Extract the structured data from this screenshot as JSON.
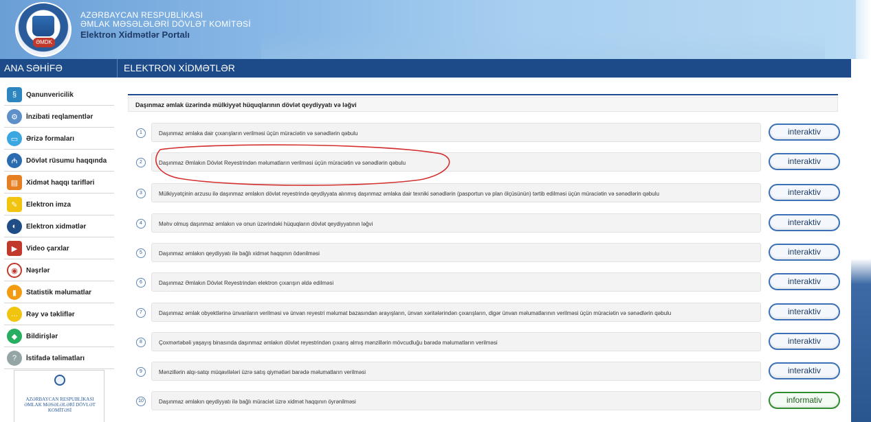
{
  "header": {
    "line1": "AZƏRBAYCAN RESPUBLİKASI",
    "line2": "ƏMLAK MƏSƏLƏLƏRİ DÖVLƏT KOMİTƏSİ",
    "line3": "Elektron Xidmətlər Portalı",
    "logo_badge": "ƏMDK"
  },
  "nav": {
    "home": "ANA SƏHİFƏ",
    "services": "ELEKTRON XİDMƏTLƏR"
  },
  "sidebar": {
    "items": [
      {
        "label": "Qanunvericilik",
        "icon": "law-icon",
        "color": "#2e86c1"
      },
      {
        "label": "İnzibati reqlamentlər",
        "icon": "gear-icon",
        "color": "#5d8fc8"
      },
      {
        "label": "Ərizə formaları",
        "icon": "form-icon",
        "color": "#3aa7e0"
      },
      {
        "label": "Dövlət rüsumu haqqında",
        "icon": "fee-icon",
        "color": "#2b6cb0"
      },
      {
        "label": "Xidmət haqqı tarifləri",
        "icon": "tariff-icon",
        "color": "#e67e22"
      },
      {
        "label": "Elektron imza",
        "icon": "signature-icon",
        "color": "#f1c40f"
      },
      {
        "label": "Elektron xidmətlər",
        "icon": "eservice-icon",
        "color": "#1f4e87"
      },
      {
        "label": "Video çarxlar",
        "icon": "video-icon",
        "color": "#c0392b"
      },
      {
        "label": "Nəşrlər",
        "icon": "publication-icon",
        "color": "#7f8c8d"
      },
      {
        "label": "Statistik məlumatlar",
        "icon": "statistics-icon",
        "color": "#f39c12"
      },
      {
        "label": "Rəy və təkliflər",
        "icon": "feedback-icon",
        "color": "#f1c40f"
      },
      {
        "label": "Bildirişlər",
        "icon": "notification-icon",
        "color": "#27ae60"
      },
      {
        "label": "İstifadə təlimatları",
        "icon": "manual-icon",
        "color": "#95a5a6"
      }
    ],
    "card_text": "AZƏRBAYCAN RESPUBLİKASI ƏMLAK MƏSƏLƏLƏRİ DÖVLƏT KOMİTƏSİ"
  },
  "main": {
    "section_title": "Daşınmaz əmlak üzərində mülkiyyət hüquqlarının dövlət qeydiyyatı və ləğvi",
    "rows": [
      {
        "num": "1",
        "text": "Daşınmaz əmlaka dair çıxarışların verilməsi üçün müraciətin və sənədlərin qəbulu",
        "button": "interaktiv",
        "type": "interactive"
      },
      {
        "num": "2",
        "text": "Daşınmaz Əmlakın Dövlət Reyestrindən məlumatların verilməsi üçün müraciətin və sənədlərin qəbulu",
        "button": "interaktiv",
        "type": "interactive"
      },
      {
        "num": "3",
        "text": "Mülkiyyətçinin arzusu ilə daşınmaz əmlakın dövlət reyestrində qeydiyyata alınmış daşınmaz əmlaka dair texniki sənədlərin (pasportun və plan ölçüsünün) tərtib edilməsi üçün müraciətin və sənədlərin qəbulu",
        "button": "interaktiv",
        "type": "interactive"
      },
      {
        "num": "4",
        "text": "Məhv olmuş daşınmaz əmlakın və onun üzərindəki hüquqların dövlət qeydiyyatının ləğvi",
        "button": "interaktiv",
        "type": "interactive"
      },
      {
        "num": "5",
        "text": "Daşınmaz əmlakın qeydiyyatı ilə bağlı xidmət haqqının ödənilməsi",
        "button": "interaktiv",
        "type": "interactive"
      },
      {
        "num": "6",
        "text": "Daşınmaz Əmlakın Dövlət Reyestrindən elektron çıxarışın əldə edilməsi",
        "button": "interaktiv",
        "type": "interactive"
      },
      {
        "num": "7",
        "text": "Daşınmaz əmlak obyektlərinə ünvanların verilməsi və ünvan reyestri məlumat bazasından arayışların, ünvan xəritələrindən çıxarışların, digər ünvan məlumatlarının verilməsi üçün müraciətin və sənədlərin qəbulu",
        "button": "interaktiv",
        "type": "interactive"
      },
      {
        "num": "8",
        "text": "Çoxmərtəbəli yaşayış binasında daşınmaz əmlakın dövlət reyestrindən çıxarış almış mənzillərin mövcudluğu barədə məlumatların verilməsi",
        "button": "interaktiv",
        "type": "interactive"
      },
      {
        "num": "9",
        "text": "Mənzillərin alqı-satqı müqavilələri üzrə satış qiymətləri barədə məlumatların verilməsi",
        "button": "interaktiv",
        "type": "interactive"
      },
      {
        "num": "10",
        "text": "Daşınmaz əmlakın qeydiyyatı ilə bağlı müraciət üzrə xidmət haqqının öyrənilməsi",
        "button": "informativ",
        "type": "informative"
      }
    ]
  },
  "colors": {
    "nav_bg": "#1d4b8a",
    "interactive_border": "#3b6fb6",
    "informative_border": "#2e8b2e",
    "annotation": "#d32f2f"
  }
}
